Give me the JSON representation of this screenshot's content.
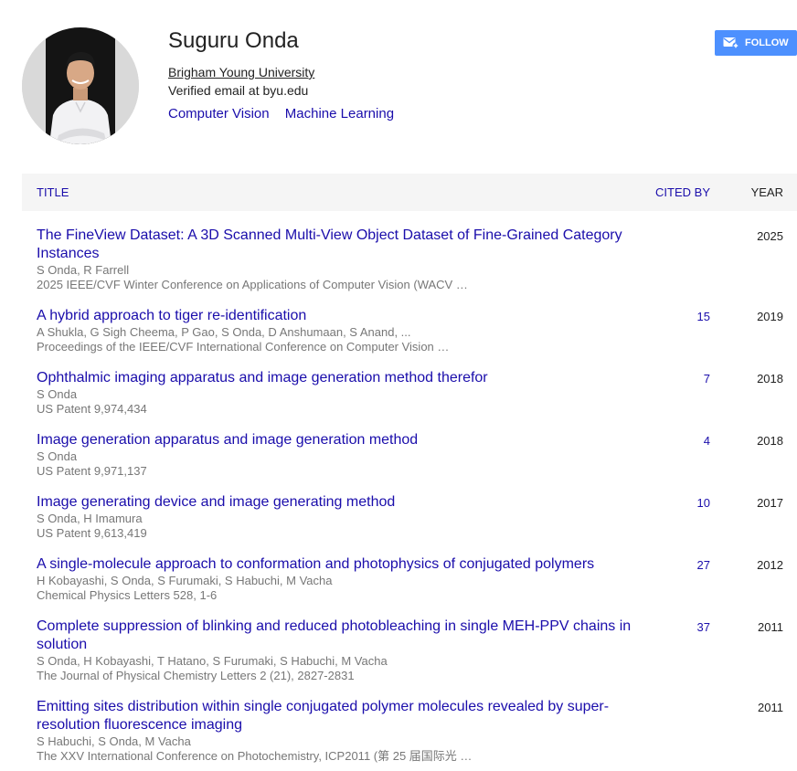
{
  "profile": {
    "name": "Suguru Onda",
    "affiliation": "Brigham Young University",
    "email": "Verified email at byu.edu",
    "interests": [
      "Computer Vision",
      "Machine Learning"
    ],
    "follow_label": "FOLLOW"
  },
  "table": {
    "headers": {
      "title": "TITLE",
      "cited_by": "CITED BY",
      "year": "YEAR"
    },
    "rows": [
      {
        "title": "The FineView Dataset: A 3D Scanned Multi-View Object Dataset of Fine-Grained Category Instances",
        "authors": "S Onda, R Farrell",
        "venue": "2025 IEEE/CVF Winter Conference on Applications of Computer Vision (WACV …",
        "cited_by": "",
        "year": "2025"
      },
      {
        "title": "A hybrid approach to tiger re-identification",
        "authors": "A Shukla, G Sigh Cheema, P Gao, S Onda, D Anshumaan, S Anand, ...",
        "venue": "Proceedings of the IEEE/CVF International Conference on Computer Vision …",
        "cited_by": "15",
        "year": "2019"
      },
      {
        "title": "Ophthalmic imaging apparatus and image generation method therefor",
        "authors": "S Onda",
        "venue": "US Patent 9,974,434",
        "cited_by": "7",
        "year": "2018"
      },
      {
        "title": "Image generation apparatus and image generation method",
        "authors": "S Onda",
        "venue": "US Patent 9,971,137",
        "cited_by": "4",
        "year": "2018"
      },
      {
        "title": "Image generating device and image generating method",
        "authors": "S Onda, H Imamura",
        "venue": "US Patent 9,613,419",
        "cited_by": "10",
        "year": "2017"
      },
      {
        "title": "A single-molecule approach to conformation and photophysics of conjugated polymers",
        "authors": "H Kobayashi, S Onda, S Furumaki, S Habuchi, M Vacha",
        "venue": "Chemical Physics Letters 528, 1-6",
        "cited_by": "27",
        "year": "2012"
      },
      {
        "title": "Complete suppression of blinking and reduced photobleaching in single MEH-PPV chains in solution",
        "authors": "S Onda, H Kobayashi, T Hatano, S Furumaki, S Habuchi, M Vacha",
        "venue": "The Journal of Physical Chemistry Letters 2 (21), 2827-2831",
        "cited_by": "37",
        "year": "2011"
      },
      {
        "title": "Emitting sites distribution within single conjugated polymer molecules revealed by super-resolution fluorescence imaging",
        "authors": "S Habuchi, S Onda, M Vacha",
        "venue": "The XXV International Conference on Photochemistry, ICP2011 (第 25 届国际光 …",
        "cited_by": "",
        "year": "2011"
      }
    ]
  },
  "colors": {
    "link": "#1a0dab",
    "follow_button": "#4d90fe",
    "header_bg": "#f5f5f5",
    "meta_text": "#777777"
  },
  "icons": {
    "follow": "mail-plus-icon"
  }
}
